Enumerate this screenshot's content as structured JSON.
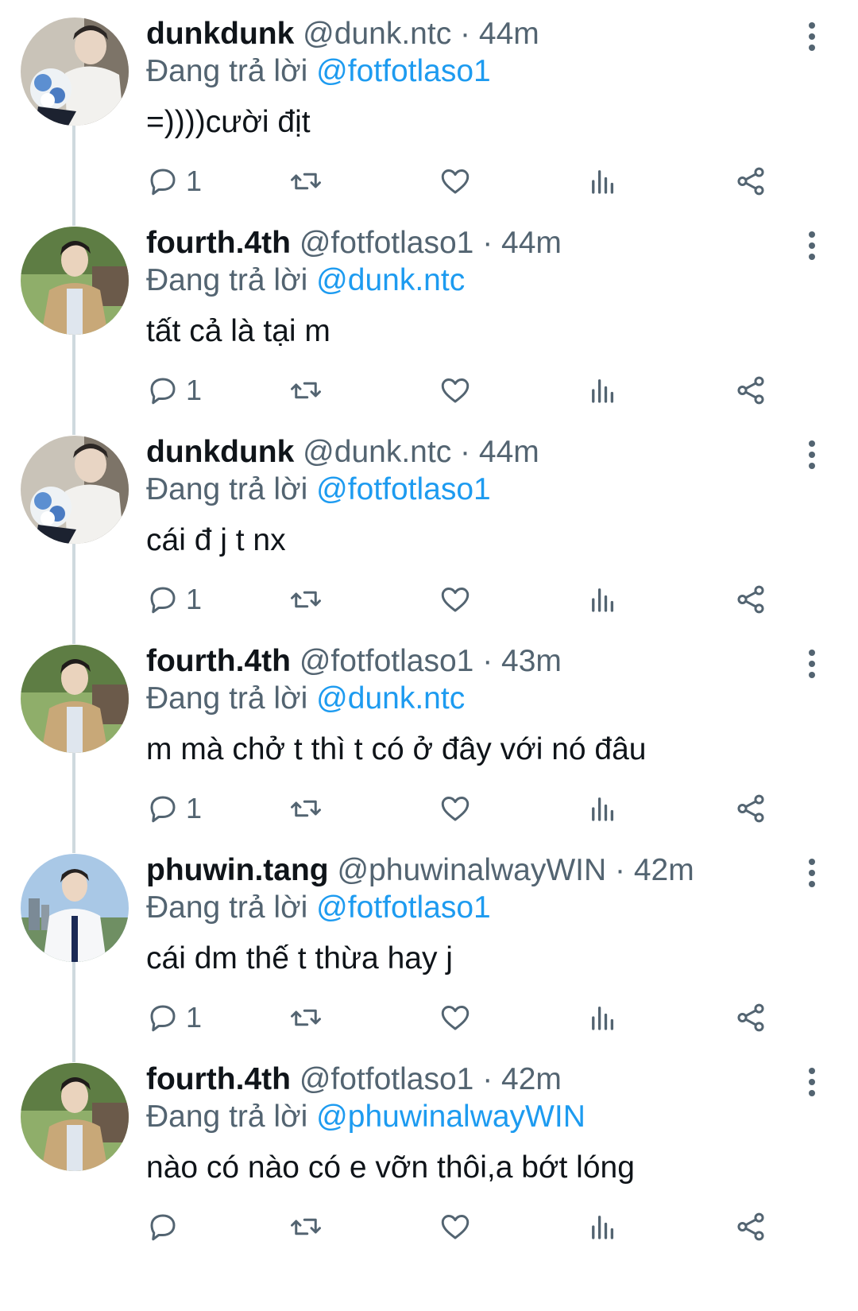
{
  "reply_prefix": "Đang trả lời",
  "tweets": [
    {
      "name": "dunkdunk",
      "handle": "@dunk.ntc",
      "separator": "·",
      "time": "44m",
      "reply_to": "@fotfotlaso1",
      "text": "=))))cười địt",
      "reply_count": "1",
      "avatar": "dunk"
    },
    {
      "name": "fourth.4th",
      "handle": "@fotfotlaso1",
      "separator": "·",
      "time": "44m",
      "reply_to": "@dunk.ntc",
      "text": "tất cả là tại m",
      "reply_count": "1",
      "avatar": "fourth"
    },
    {
      "name": "dunkdunk",
      "handle": "@dunk.ntc",
      "separator": "·",
      "time": "44m",
      "reply_to": "@fotfotlaso1",
      "text": "cái đ j t nx",
      "reply_count": "1",
      "avatar": "dunk"
    },
    {
      "name": "fourth.4th",
      "handle": "@fotfotlaso1",
      "separator": "·",
      "time": "43m",
      "reply_to": "@dunk.ntc",
      "text": "m mà chở t thì t có ở đây với nó đâu",
      "reply_count": "1",
      "avatar": "fourth"
    },
    {
      "name": "phuwin.tang",
      "handle": "@phuwinalwayWIN",
      "separator": "·",
      "time": "42m",
      "reply_to": "@fotfotlaso1",
      "text": "cái dm thế t thừa hay j",
      "reply_count": "1",
      "avatar": "phuwin"
    },
    {
      "name": "fourth.4th",
      "handle": "@fotfotlaso1",
      "separator": "·",
      "time": "42m",
      "reply_to": "@phuwinalwayWIN",
      "text": "nào có nào có e vỡn thôi,a bớt lóng",
      "reply_count": "",
      "avatar": "fourth"
    }
  ],
  "icons": {
    "reply": "reply-icon",
    "retweet": "retweet-icon",
    "like": "heart-icon",
    "views": "views-chart-icon",
    "share": "share-icon",
    "more": "more-vertical-icon"
  },
  "colors": {
    "text": "#0f1419",
    "secondary": "#536471",
    "mention": "#1d9bf0",
    "thread_line": "#cfd9de"
  }
}
